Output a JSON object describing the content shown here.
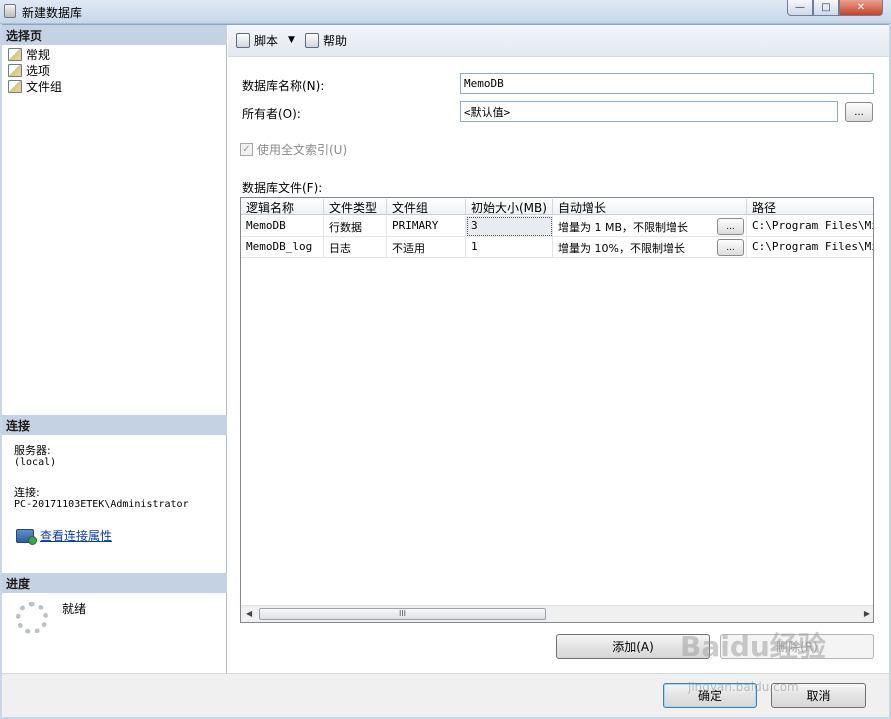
{
  "window": {
    "title": "新建数据库",
    "controls": {
      "minimize": "—",
      "maximize": "□",
      "close": "✕"
    }
  },
  "left": {
    "select_page": {
      "heading": "选择页",
      "items": [
        {
          "label": "常规",
          "icon": "page-icon"
        },
        {
          "label": "选项",
          "icon": "page-icon"
        },
        {
          "label": "文件组",
          "icon": "page-icon"
        }
      ]
    },
    "connection": {
      "heading": "连接",
      "server_label": "服务器:",
      "server_value": "(local)",
      "conn_label": "连接:",
      "conn_value": "PC-20171103ETEK\\Administrator",
      "view_link": "查看连接属性"
    },
    "progress": {
      "heading": "进度",
      "status": "就绪"
    }
  },
  "toolbar": {
    "script_label": "脚本",
    "help_label": "帮助"
  },
  "form": {
    "db_name_label": "数据库名称(N):",
    "db_name_value": "MemoDB",
    "owner_label": "所有者(O):",
    "owner_value": "<默认值>",
    "browse_label": "...",
    "fulltext_label": "使用全文索引(U)",
    "fulltext_checked": true,
    "files_label": "数据库文件(F):"
  },
  "grid": {
    "columns": [
      "逻辑名称",
      "文件类型",
      "文件组",
      "初始大小(MB)",
      "自动增长",
      "路径"
    ],
    "rows": [
      {
        "name": "MemoDB",
        "type": "行数据",
        "filegroup": "PRIMARY",
        "size": "3",
        "growth": "增量为 1 MB，不限制增长",
        "path": "C:\\Program Files\\Mic"
      },
      {
        "name": "MemoDB_log",
        "type": "日志",
        "filegroup": "不适用",
        "size": "1",
        "growth": "增量为 10%，不限制增长",
        "path": "C:\\Program Files\\Mic"
      }
    ],
    "cell_button": "...",
    "scroll_left": "◀",
    "scroll_right": "▶",
    "scroll_grip": "III"
  },
  "buttons": {
    "add": "添加(A)",
    "remove": "删除(R)",
    "ok": "确定",
    "cancel": "取消"
  },
  "watermark": {
    "brand": "Baidu经验",
    "url": "jingyan.baidu.com"
  }
}
